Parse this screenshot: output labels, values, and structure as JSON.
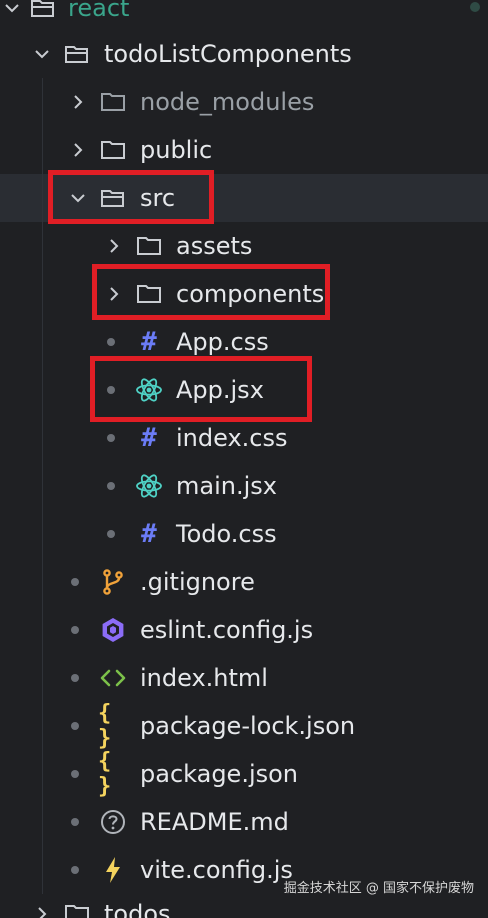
{
  "explorer": {
    "items": [
      {
        "label": "react",
        "kind": "folder-open"
      },
      {
        "label": "todoListComponents",
        "kind": "folder-open"
      },
      {
        "label": "node_modules",
        "kind": "folder-closed"
      },
      {
        "label": "public",
        "kind": "folder-closed"
      },
      {
        "label": "src",
        "kind": "folder-open"
      },
      {
        "label": "assets",
        "kind": "folder-closed"
      },
      {
        "label": "components",
        "kind": "folder-closed"
      },
      {
        "label": "App.css",
        "kind": "css-file"
      },
      {
        "label": "App.jsx",
        "kind": "react-file"
      },
      {
        "label": "index.css",
        "kind": "css-file"
      },
      {
        "label": "main.jsx",
        "kind": "react-file"
      },
      {
        "label": "Todo.css",
        "kind": "css-file"
      },
      {
        "label": ".gitignore",
        "kind": "git-file"
      },
      {
        "label": "eslint.config.js",
        "kind": "eslint-file"
      },
      {
        "label": "index.html",
        "kind": "html-file"
      },
      {
        "label": "package-lock.json",
        "kind": "json-file"
      },
      {
        "label": "package.json",
        "kind": "json-file"
      },
      {
        "label": "README.md",
        "kind": "readme-file"
      },
      {
        "label": "vite.config.js",
        "kind": "vite-file"
      },
      {
        "label": "todos",
        "kind": "folder-closed"
      }
    ],
    "css_icon_glyph": "#",
    "json_icon_glyph": "{ }"
  },
  "watermark": "掘金技术社区 @ 国家不保护废物",
  "colors": {
    "background": "#1f2023",
    "text": "#e6e8eb",
    "muted_text": "#9aa0a6",
    "highlight_box": "#e01e25",
    "css_icon": "#6b7cf6",
    "react_icon": "#4fd1c5",
    "git_icon": "#f0a23a",
    "eslint_icon": "#8b6cf6",
    "html_icon": "#7cc14a",
    "json_icon": "#f4d35e",
    "vite_icon": "#f4d35e"
  }
}
